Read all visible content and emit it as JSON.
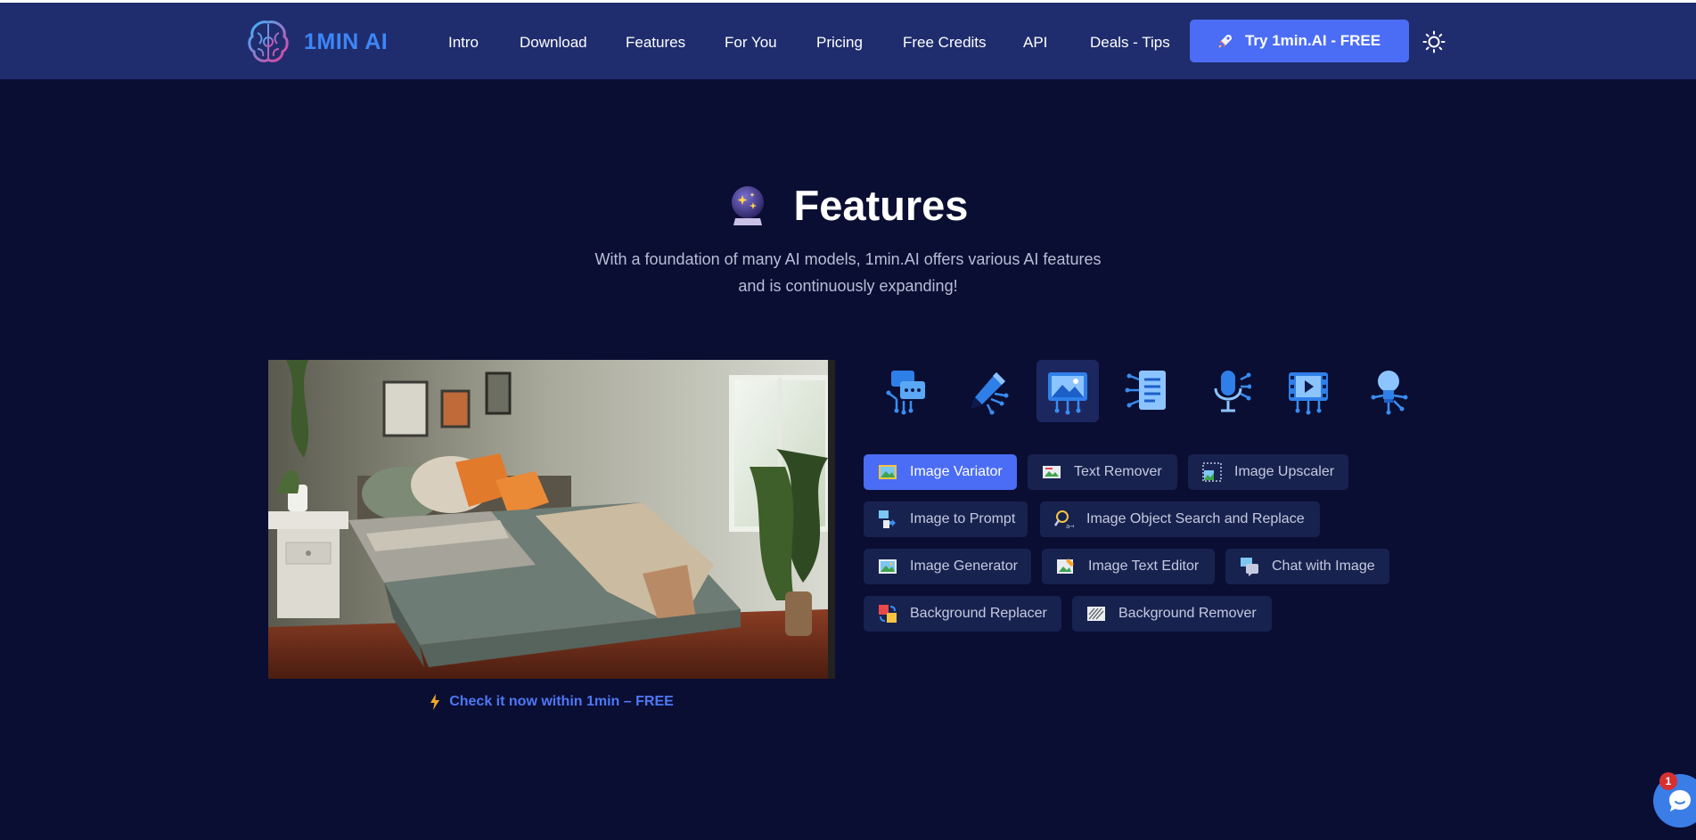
{
  "brand": {
    "name": "1MIN AI"
  },
  "nav": {
    "items": [
      "Intro",
      "Download",
      "Features",
      "For You",
      "Pricing",
      "Free Credits",
      "API",
      "Deals - Tips"
    ],
    "cta_label": "Try 1min.AI - FREE"
  },
  "section": {
    "title": "Features",
    "subtitle_line1": "With a foundation of many AI models, 1min.AI offers various AI features",
    "subtitle_line2": "and is continuously expanding!",
    "cta": "Check it now within 1min – FREE"
  },
  "categories": [
    {
      "icon": "chat-icon"
    },
    {
      "icon": "pen-icon"
    },
    {
      "icon": "image-icon",
      "active": true
    },
    {
      "icon": "document-icon"
    },
    {
      "icon": "microphone-icon"
    },
    {
      "icon": "video-icon"
    },
    {
      "icon": "lightbulb-icon"
    }
  ],
  "features": [
    {
      "label": "Image Variator",
      "icon": "image-variator-icon",
      "active": true
    },
    {
      "label": "Text Remover",
      "icon": "text-remover-icon"
    },
    {
      "label": "Image Upscaler",
      "icon": "image-upscaler-icon"
    },
    {
      "label": "Image to Prompt",
      "icon": "image-to-prompt-icon"
    },
    {
      "label": "Image Object Search and Replace",
      "icon": "search-replace-icon"
    },
    {
      "label": "Image Generator",
      "icon": "image-generator-icon"
    },
    {
      "label": "Image Text Editor",
      "icon": "image-text-editor-icon"
    },
    {
      "label": "Chat with Image",
      "icon": "chat-with-image-icon"
    },
    {
      "label": "Background Replacer",
      "icon": "background-replacer-icon"
    },
    {
      "label": "Background Remover",
      "icon": "background-remover-icon"
    }
  ],
  "chat_widget": {
    "badge": "1"
  },
  "colors": {
    "background": "#0a0e33",
    "header": "#1f2d6e",
    "accent": "#4b6df5",
    "link": "#4d78f6"
  }
}
